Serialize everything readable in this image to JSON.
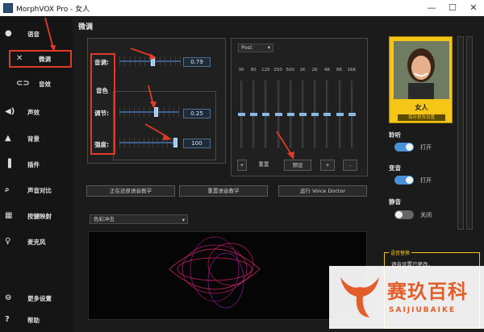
{
  "window": {
    "title": "MorphVOX Pro - 女人",
    "min": "—",
    "max": "☐",
    "close": "✕"
  },
  "sidebar": {
    "items": [
      {
        "label": "语音",
        "icon": "voice-icon"
      },
      {
        "label": "微调",
        "icon": "tools-icon"
      },
      {
        "label": "音效",
        "icon": "lips-icon"
      },
      {
        "label": "声效",
        "icon": "speaker-icon"
      },
      {
        "label": "背景",
        "icon": "landscape-icon"
      },
      {
        "label": "插件",
        "icon": "plugin-icon"
      },
      {
        "label": "声音对比",
        "icon": "magnifier-icon"
      },
      {
        "label": "按键映射",
        "icon": "keyboard-icon"
      },
      {
        "label": "麦克风",
        "icon": "microphone-icon"
      },
      {
        "label": "更多设置",
        "icon": "more-icon"
      },
      {
        "label": "帮助",
        "icon": "help-icon"
      }
    ]
  },
  "tweak": {
    "title": "微调",
    "pitch_label": "音调:",
    "pitch_value": "0.79",
    "pitch_level": 0.55,
    "timbre_label": "音色",
    "adjust_label": "调节:",
    "adjust_value": "0.25",
    "adjust_level": 0.62,
    "strength_label": "强度:",
    "strength_value": "100",
    "strength_level": 1.0
  },
  "eq": {
    "mode": "Post",
    "bands": [
      "30",
      "60",
      "125",
      "250",
      "500",
      "1K",
      "2K",
      "4K",
      "8K",
      "16K"
    ],
    "band_levels": [
      0.5,
      0.5,
      0.5,
      0.5,
      0.5,
      0.5,
      0.5,
      0.5,
      0.5,
      0.5
    ],
    "add": "+",
    "reset": "重置",
    "preset": "预设",
    "plus": "+",
    "minus": "-"
  },
  "actions": {
    "restoring": "正在还原语音教学",
    "reset_teach": "重置语音教学",
    "voice_doctor": "运行 Voice Doctor"
  },
  "viz": {
    "mode": "色彩冲击"
  },
  "voice": {
    "name": "女人",
    "save_changes": "保存更改设置",
    "listen_label": "聆听",
    "listen_state": "打开",
    "change_label": "变音",
    "change_state": "打开",
    "mute_label": "静音",
    "mute_state": "关闭"
  },
  "notice": {
    "title": "语音替换",
    "message": "语音设置已更改。"
  },
  "watermark": {
    "brand": "赛玖百科",
    "brand_latin": "SAIJIUBAIKE"
  },
  "colors": {
    "accent": "#f5c518",
    "annotation": "#e03a2a",
    "toggle_on": "#4a90d9",
    "toggle_off": "#666666"
  }
}
